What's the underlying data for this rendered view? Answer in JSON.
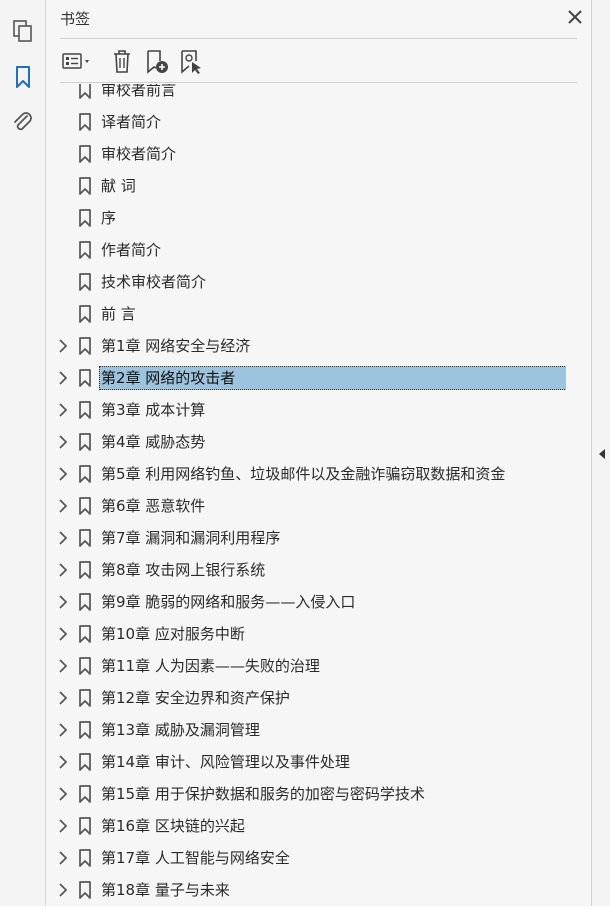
{
  "panel": {
    "title": "书签"
  },
  "left_toolbar": {
    "icons": [
      "page-thumbnails-icon",
      "bookmarks-icon",
      "attachments-icon"
    ],
    "active": "bookmarks-icon"
  },
  "toolbar": {
    "icons": [
      "options-icon",
      "delete-bookmark-icon",
      "new-bookmark-icon",
      "new-bookmark-from-structure-icon"
    ]
  },
  "bookmarks": [
    {
      "label": "审校者前言",
      "expandable": false,
      "partial": true
    },
    {
      "label": "译者简介",
      "expandable": false
    },
    {
      "label": "审校者简介",
      "expandable": false
    },
    {
      "label": "献 词",
      "expandable": false
    },
    {
      "label": "序",
      "expandable": false
    },
    {
      "label": "作者简介",
      "expandable": false
    },
    {
      "label": "技术审校者简介",
      "expandable": false
    },
    {
      "label": "前 言",
      "expandable": false
    },
    {
      "label": "第1章 网络安全与经济",
      "expandable": true
    },
    {
      "label": "第2章 网络的攻击者",
      "expandable": true,
      "selected": true
    },
    {
      "label": "第3章 成本计算",
      "expandable": true
    },
    {
      "label": "第4章 威胁态势",
      "expandable": true
    },
    {
      "label": "第5章 利用网络钓鱼、垃圾邮件以及金融诈骗窃取数据和资金",
      "expandable": true
    },
    {
      "label": "第6章 恶意软件",
      "expandable": true
    },
    {
      "label": "第7章 漏洞和漏洞利用程序",
      "expandable": true
    },
    {
      "label": "第8章 攻击网上银行系统",
      "expandable": true
    },
    {
      "label": "第9章 脆弱的网络和服务——入侵入口",
      "expandable": true
    },
    {
      "label": "第10章 应对服务中断",
      "expandable": true
    },
    {
      "label": "第11章 人为因素——失败的治理",
      "expandable": true
    },
    {
      "label": "第12章 安全边界和资产保护",
      "expandable": true
    },
    {
      "label": "第13章 威胁及漏洞管理",
      "expandable": true
    },
    {
      "label": "第14章 审计、风险管理以及事件处理",
      "expandable": true
    },
    {
      "label": "第15章 用于保护数据和服务的加密与密码学技术",
      "expandable": true
    },
    {
      "label": "第16章 区块链的兴起",
      "expandable": true
    },
    {
      "label": "第17章 人工智能与网络安全",
      "expandable": true
    },
    {
      "label": "第18章 量子与未来",
      "expandable": true
    }
  ],
  "colors": {
    "selection": "#9cc4df",
    "accent": "#1f6fc4"
  }
}
